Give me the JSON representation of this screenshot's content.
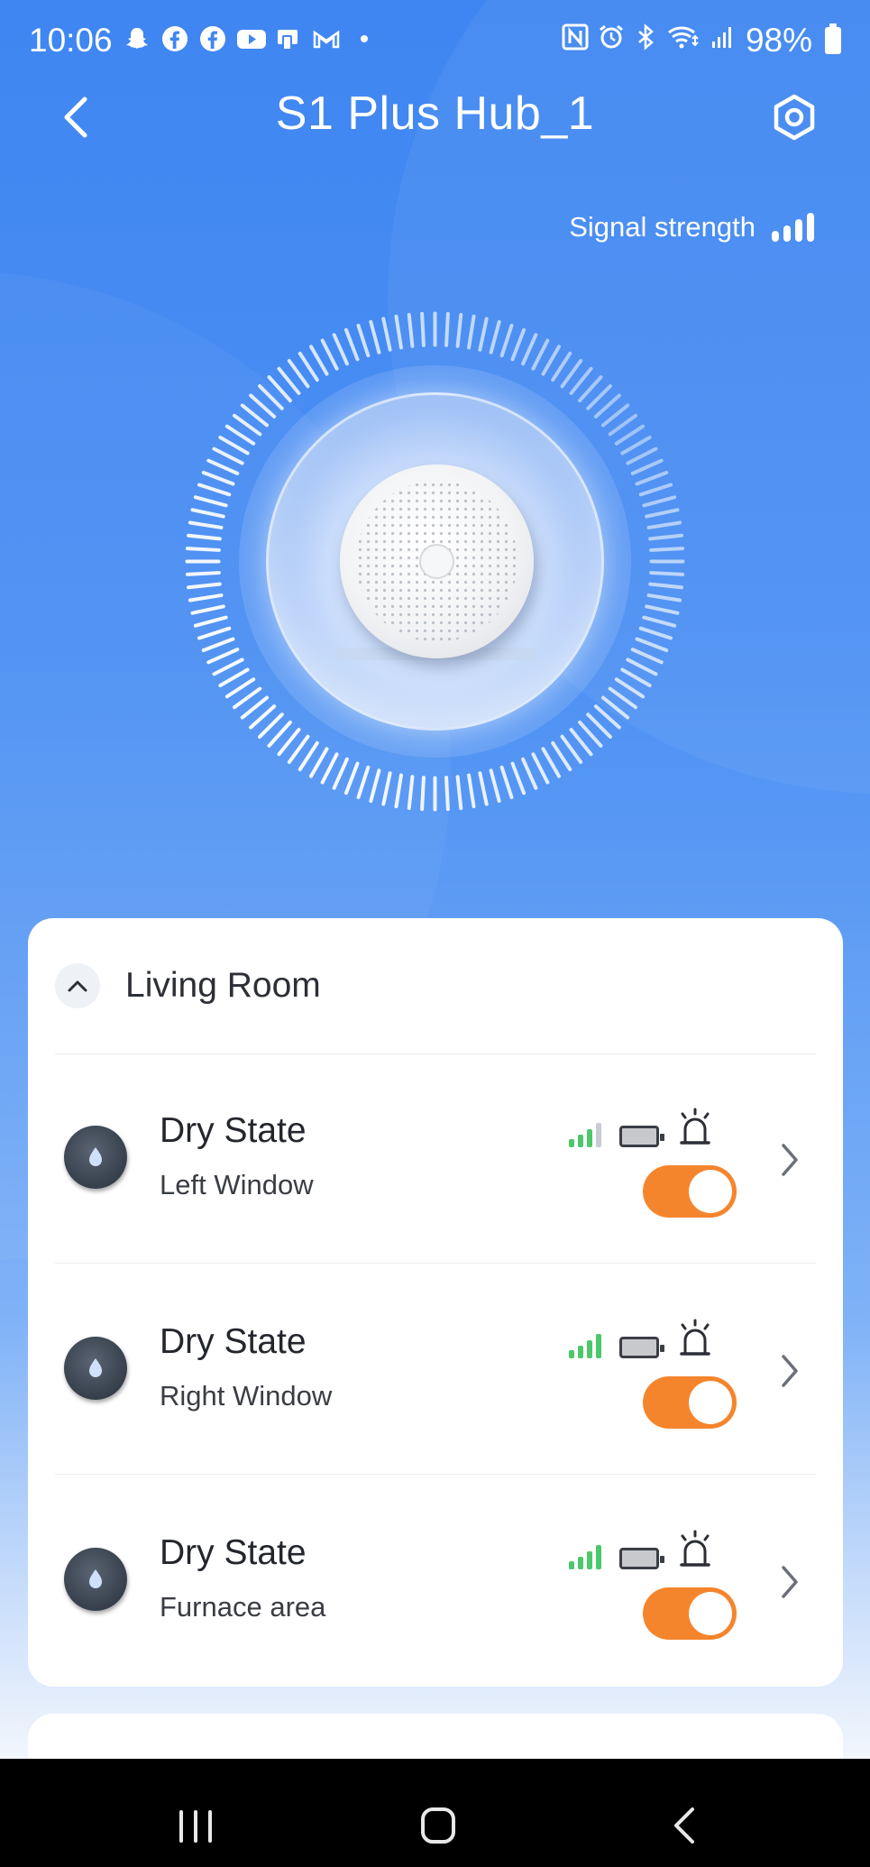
{
  "status_bar": {
    "time": "10:06",
    "battery": "98%",
    "left_icons": [
      "snapchat-icon",
      "facebook-icon",
      "facebook-icon",
      "youtube-icon",
      "tablet-icon",
      "gmail-icon",
      "dot-icon"
    ],
    "right_icons": [
      "nfc-icon",
      "alarm-icon",
      "bluetooth-icon",
      "wifi-icon",
      "cell-signal-icon",
      "battery-icon"
    ]
  },
  "header": {
    "title": "S1 Plus Hub_1",
    "signal_label": "Signal strength"
  },
  "colors": {
    "accent_blue": "#3f86f2",
    "toggle_on": "#f5852c",
    "signal_green": "#4cc86a"
  },
  "room": {
    "name": "Living Room",
    "expanded": true
  },
  "devices": [
    {
      "name": "Dry State",
      "location": "Left Window",
      "signal_bars_lit": 3,
      "toggle_on": true
    },
    {
      "name": "Dry State",
      "location": "Right Window",
      "signal_bars_lit": 4,
      "toggle_on": true
    },
    {
      "name": "Dry State",
      "location": "Furnace area",
      "signal_bars_lit": 4,
      "toggle_on": true
    }
  ]
}
